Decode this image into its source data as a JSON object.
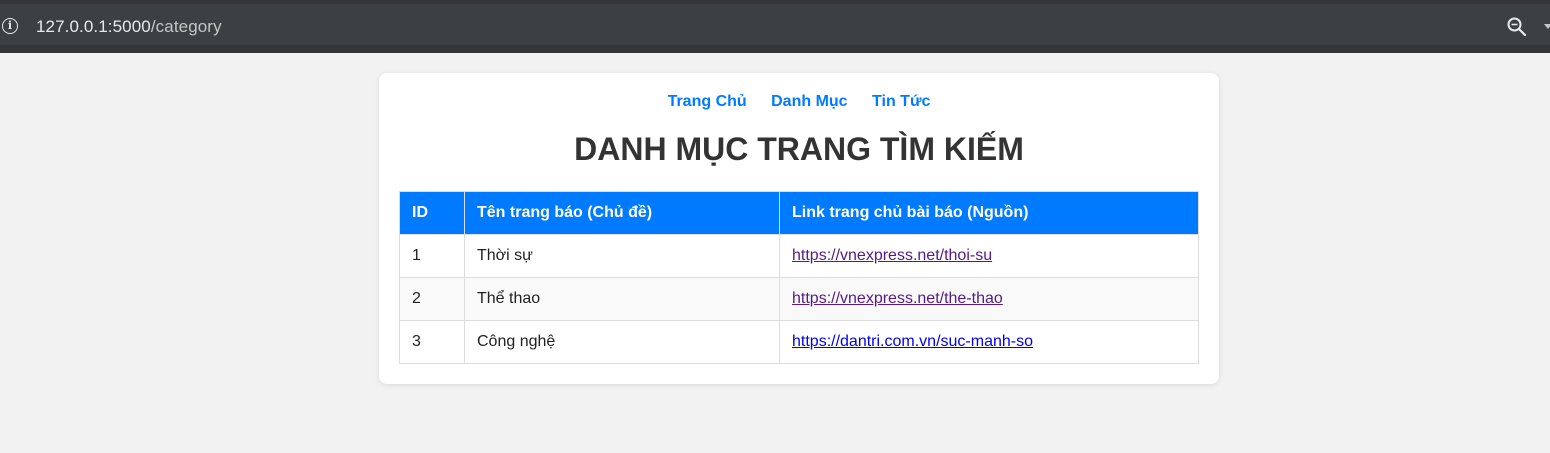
{
  "browser": {
    "url_host": "127.0.0.1:5000",
    "url_path": "/category"
  },
  "nav": [
    {
      "label": "Trang Chủ"
    },
    {
      "label": "Danh Mục"
    },
    {
      "label": "Tin Tức"
    }
  ],
  "page": {
    "title": "DANH MỤC TRANG TÌM KIẾM"
  },
  "table": {
    "headers": [
      "ID",
      "Tên trang báo (Chủ đề)",
      "Link trang chủ bài báo (Nguồn)"
    ],
    "rows": [
      {
        "id": "1",
        "name": "Thời sự",
        "link": "https://vnexpress.net/thoi-su"
      },
      {
        "id": "2",
        "name": "Thể thao",
        "link": "https://vnexpress.net/the-thao"
      },
      {
        "id": "3",
        "name": "Công nghệ",
        "link": "https://dantri.com.vn/suc-manh-so"
      }
    ]
  },
  "colors": {
    "accent": "#007bff",
    "visited_link": "#551a8b",
    "link": "#0000ee"
  },
  "icons": [
    "info-icon",
    "zoom-icon",
    "menu-caret-icon"
  ]
}
